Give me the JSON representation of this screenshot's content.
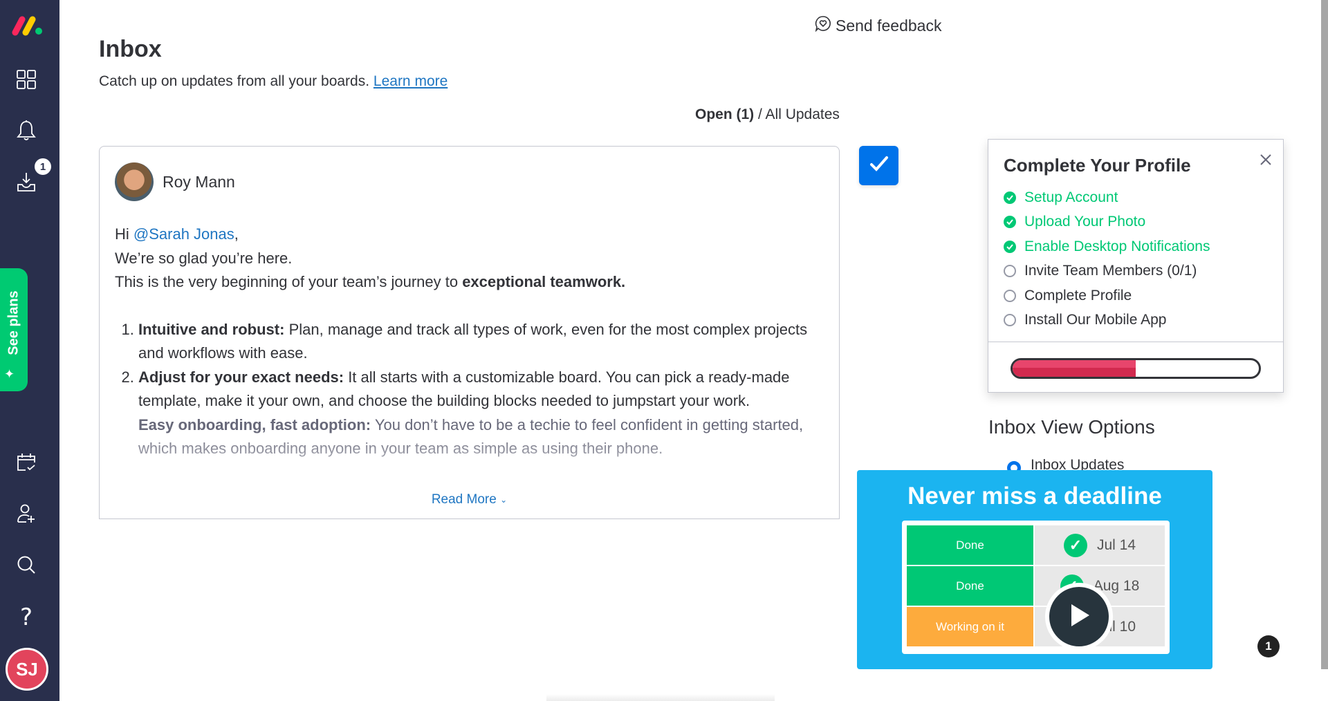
{
  "sidebar": {
    "logo": "monday-logo",
    "items": [
      {
        "name": "workspaces",
        "icon": "grid-icon"
      },
      {
        "name": "notifications",
        "icon": "bell-icon"
      },
      {
        "name": "inbox",
        "icon": "inbox-download-icon",
        "badge": "1"
      },
      {
        "name": "my-work",
        "icon": "calendar-check-icon"
      },
      {
        "name": "invite-members",
        "icon": "user-plus-icon"
      },
      {
        "name": "search",
        "icon": "search-icon"
      },
      {
        "name": "help",
        "icon": "question-icon"
      }
    ],
    "see_plans_label": "See plans",
    "user_initials": "SJ"
  },
  "header": {
    "title": "Inbox",
    "subtitle": "Catch up on updates from all your boards.",
    "learn_more": "Learn more",
    "feedback_label": "Send feedback"
  },
  "filter": {
    "open_label": "Open (1)",
    "separator": " / ",
    "all_label": "All Updates"
  },
  "update": {
    "author": "Roy Mann",
    "greeting_prefix": "Hi ",
    "mention": "@Sarah Jonas",
    "greeting_suffix": ",",
    "line2": "We’re so glad you’re here.",
    "line3_prefix": "This is the very beginning of your team’s journey to ",
    "line3_bold": "exceptional teamwork.",
    "points": [
      {
        "title": "Intuitive and robust:",
        "text": " Plan, manage and track all types of work, even for the most complex projects and workflows with ease."
      },
      {
        "title": "Adjust for your exact needs:",
        "text": " It all starts with a customizable board. You can pick a ready-made template, make it your own, and choose the building blocks needed to jumpstart your work."
      },
      {
        "title": "Easy onboarding, fast adoption:",
        "text": " You don’t have to be a techie to feel confident in getting started, which makes onboarding anyone in your team as simple as using their phone."
      }
    ],
    "read_more": "Read More"
  },
  "profile": {
    "title": "Complete Your Profile",
    "items": [
      {
        "label": "Setup Account",
        "done": true
      },
      {
        "label": "Upload Your Photo",
        "done": true
      },
      {
        "label": "Enable Desktop Notifications",
        "done": true
      },
      {
        "label": "Invite Team Members (0/1)",
        "done": false
      },
      {
        "label": "Complete Profile",
        "done": false
      },
      {
        "label": "Install Our Mobile App",
        "done": false
      }
    ],
    "progress_percent": 50
  },
  "view_options": {
    "title": "Inbox View Options",
    "selected": "Inbox Updates"
  },
  "promo": {
    "title": "Never miss a deadline",
    "rows": [
      {
        "status": "Done",
        "status_color": "#00c875",
        "date": "Jul 14",
        "icon": "check-circle-icon",
        "icon_color": "#00c875"
      },
      {
        "status": "Done",
        "status_color": "#00c875",
        "date": "Aug 18",
        "icon": "check-circle-icon",
        "icon_color": "#00c875"
      },
      {
        "status": "Working on it",
        "status_color": "#fdab3d",
        "date": "Jul 10",
        "icon": "alert-circle-icon",
        "icon_color": "#e2445c"
      }
    ]
  },
  "notification_count": "1",
  "colors": {
    "sidebar_bg": "#292f4c",
    "accent": "#0073ea",
    "done": "#00c875",
    "progress": "#e2445c",
    "promo_bg": "#1bb4f0",
    "see_plans": "#00ca72"
  }
}
